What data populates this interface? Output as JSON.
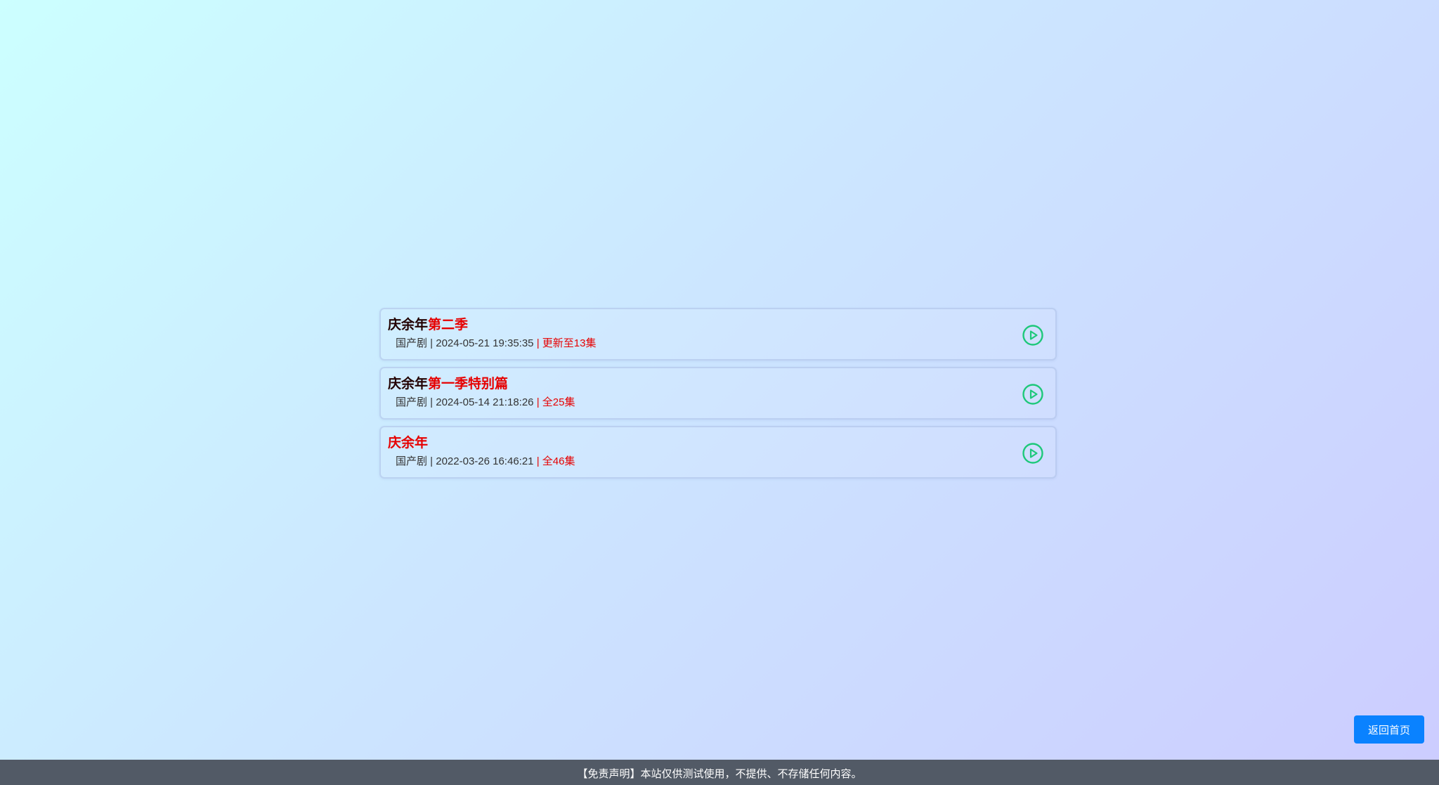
{
  "results": [
    {
      "title_main": "庆余年",
      "title_sub": "第二季",
      "meta_left": "国产剧 | 2024-05-21 19:35:35",
      "meta_right": " | 更新至13集"
    },
    {
      "title_main": "庆余年",
      "title_sub": "第一季特别篇",
      "meta_left": "国产剧 | 2024-05-14 21:18:26",
      "meta_right": " | 全25集"
    },
    {
      "title_main": "",
      "title_sub": "庆余年",
      "meta_left": "国产剧 | 2022-03-26 16:46:21",
      "meta_right": " | 全46集"
    }
  ],
  "home_button": {
    "label": "返回首页"
  },
  "footer": {
    "disclaimer": "【免责声明】本站仅供测试使用，不提供、不存储任何内容。"
  },
  "icons": {
    "play": "play-circle-icon"
  },
  "colors": {
    "accent_red": "#e60000",
    "play_green": "#1ec87a",
    "button_blue": "#0a82ff",
    "footer_bg": "#525a66"
  }
}
